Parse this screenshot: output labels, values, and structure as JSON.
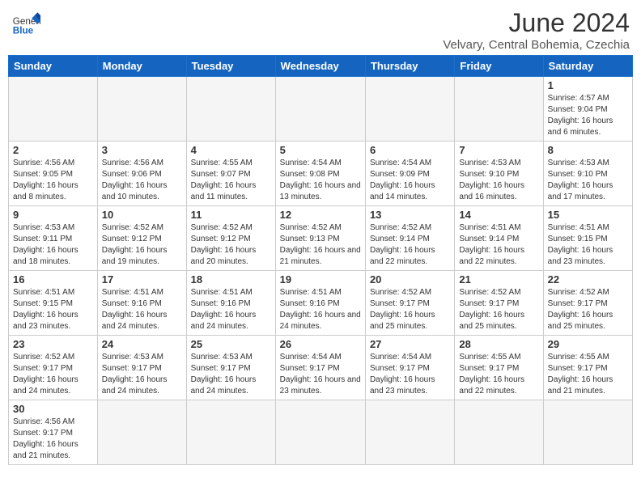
{
  "header": {
    "logo_general": "General",
    "logo_blue": "Blue",
    "title": "June 2024",
    "location": "Velvary, Central Bohemia, Czechia"
  },
  "days_of_week": [
    "Sunday",
    "Monday",
    "Tuesday",
    "Wednesday",
    "Thursday",
    "Friday",
    "Saturday"
  ],
  "weeks": [
    [
      {
        "day": "",
        "info": ""
      },
      {
        "day": "",
        "info": ""
      },
      {
        "day": "",
        "info": ""
      },
      {
        "day": "",
        "info": ""
      },
      {
        "day": "",
        "info": ""
      },
      {
        "day": "",
        "info": ""
      },
      {
        "day": "1",
        "info": "Sunrise: 4:57 AM\nSunset: 9:04 PM\nDaylight: 16 hours and 6 minutes."
      }
    ],
    [
      {
        "day": "2",
        "info": "Sunrise: 4:56 AM\nSunset: 9:05 PM\nDaylight: 16 hours and 8 minutes."
      },
      {
        "day": "3",
        "info": "Sunrise: 4:56 AM\nSunset: 9:06 PM\nDaylight: 16 hours and 10 minutes."
      },
      {
        "day": "4",
        "info": "Sunrise: 4:55 AM\nSunset: 9:07 PM\nDaylight: 16 hours and 11 minutes."
      },
      {
        "day": "5",
        "info": "Sunrise: 4:54 AM\nSunset: 9:08 PM\nDaylight: 16 hours and 13 minutes."
      },
      {
        "day": "6",
        "info": "Sunrise: 4:54 AM\nSunset: 9:09 PM\nDaylight: 16 hours and 14 minutes."
      },
      {
        "day": "7",
        "info": "Sunrise: 4:53 AM\nSunset: 9:10 PM\nDaylight: 16 hours and 16 minutes."
      },
      {
        "day": "8",
        "info": "Sunrise: 4:53 AM\nSunset: 9:10 PM\nDaylight: 16 hours and 17 minutes."
      }
    ],
    [
      {
        "day": "9",
        "info": "Sunrise: 4:53 AM\nSunset: 9:11 PM\nDaylight: 16 hours and 18 minutes."
      },
      {
        "day": "10",
        "info": "Sunrise: 4:52 AM\nSunset: 9:12 PM\nDaylight: 16 hours and 19 minutes."
      },
      {
        "day": "11",
        "info": "Sunrise: 4:52 AM\nSunset: 9:12 PM\nDaylight: 16 hours and 20 minutes."
      },
      {
        "day": "12",
        "info": "Sunrise: 4:52 AM\nSunset: 9:13 PM\nDaylight: 16 hours and 21 minutes."
      },
      {
        "day": "13",
        "info": "Sunrise: 4:52 AM\nSunset: 9:14 PM\nDaylight: 16 hours and 22 minutes."
      },
      {
        "day": "14",
        "info": "Sunrise: 4:51 AM\nSunset: 9:14 PM\nDaylight: 16 hours and 22 minutes."
      },
      {
        "day": "15",
        "info": "Sunrise: 4:51 AM\nSunset: 9:15 PM\nDaylight: 16 hours and 23 minutes."
      }
    ],
    [
      {
        "day": "16",
        "info": "Sunrise: 4:51 AM\nSunset: 9:15 PM\nDaylight: 16 hours and 23 minutes."
      },
      {
        "day": "17",
        "info": "Sunrise: 4:51 AM\nSunset: 9:16 PM\nDaylight: 16 hours and 24 minutes."
      },
      {
        "day": "18",
        "info": "Sunrise: 4:51 AM\nSunset: 9:16 PM\nDaylight: 16 hours and 24 minutes."
      },
      {
        "day": "19",
        "info": "Sunrise: 4:51 AM\nSunset: 9:16 PM\nDaylight: 16 hours and 24 minutes."
      },
      {
        "day": "20",
        "info": "Sunrise: 4:52 AM\nSunset: 9:17 PM\nDaylight: 16 hours and 25 minutes."
      },
      {
        "day": "21",
        "info": "Sunrise: 4:52 AM\nSunset: 9:17 PM\nDaylight: 16 hours and 25 minutes."
      },
      {
        "day": "22",
        "info": "Sunrise: 4:52 AM\nSunset: 9:17 PM\nDaylight: 16 hours and 25 minutes."
      }
    ],
    [
      {
        "day": "23",
        "info": "Sunrise: 4:52 AM\nSunset: 9:17 PM\nDaylight: 16 hours and 24 minutes."
      },
      {
        "day": "24",
        "info": "Sunrise: 4:53 AM\nSunset: 9:17 PM\nDaylight: 16 hours and 24 minutes."
      },
      {
        "day": "25",
        "info": "Sunrise: 4:53 AM\nSunset: 9:17 PM\nDaylight: 16 hours and 24 minutes."
      },
      {
        "day": "26",
        "info": "Sunrise: 4:54 AM\nSunset: 9:17 PM\nDaylight: 16 hours and 23 minutes."
      },
      {
        "day": "27",
        "info": "Sunrise: 4:54 AM\nSunset: 9:17 PM\nDaylight: 16 hours and 23 minutes."
      },
      {
        "day": "28",
        "info": "Sunrise: 4:55 AM\nSunset: 9:17 PM\nDaylight: 16 hours and 22 minutes."
      },
      {
        "day": "29",
        "info": "Sunrise: 4:55 AM\nSunset: 9:17 PM\nDaylight: 16 hours and 21 minutes."
      }
    ],
    [
      {
        "day": "30",
        "info": "Sunrise: 4:56 AM\nSunset: 9:17 PM\nDaylight: 16 hours and 21 minutes."
      },
      {
        "day": "",
        "info": ""
      },
      {
        "day": "",
        "info": ""
      },
      {
        "day": "",
        "info": ""
      },
      {
        "day": "",
        "info": ""
      },
      {
        "day": "",
        "info": ""
      },
      {
        "day": "",
        "info": ""
      }
    ]
  ]
}
